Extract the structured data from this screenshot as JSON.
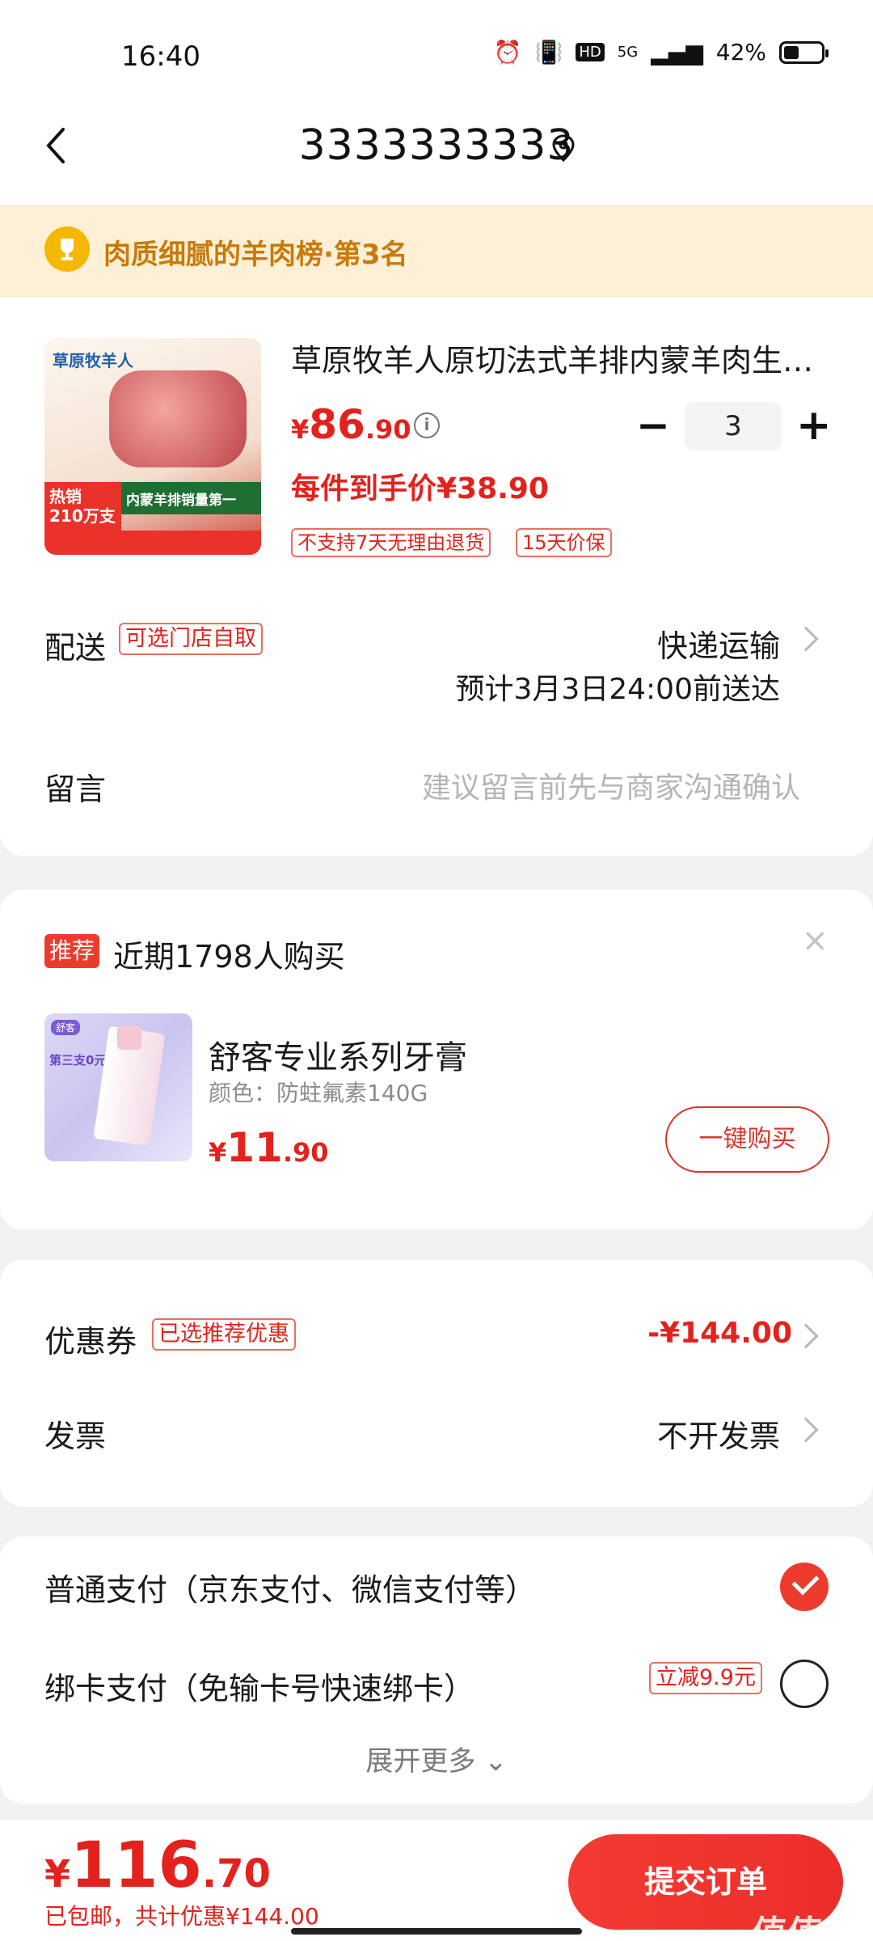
{
  "status_bar": {
    "time": "16:40",
    "network": "5G",
    "hd": "HD",
    "battery": "42%"
  },
  "header": {
    "phone": "3333333333"
  },
  "ranking": {
    "text": "肉质细腻的羊肉榜·第3名"
  },
  "product": {
    "image_brand": "草原牧羊人",
    "image_hot": "热销",
    "image_sales": "210万支",
    "image_banner": "内蒙羊排销量第一",
    "title": "草原牧羊人原切法式羊排内蒙羊肉生…",
    "price_currency": "¥",
    "price_int": "86",
    "price_dec": ".90",
    "quantity": "3",
    "unit_price": "每件到手价¥38.90",
    "tags": [
      "不支持7天无理由退货",
      "15天价保"
    ]
  },
  "delivery": {
    "label": "配送",
    "tag": "可选门店自取",
    "method": "快递运输",
    "eta": "预计3月3日24:00前送达"
  },
  "note": {
    "label": "留言",
    "placeholder": "建议留言前先与商家沟通确认"
  },
  "recommend": {
    "badge": "推荐",
    "count_text": "近期1798人购买",
    "close": "×",
    "image_pill": "舒客",
    "image_text": "第三支0元",
    "name": "舒客专业系列牙膏",
    "variant": "颜色：防蛀氟素140G",
    "price_currency": "¥",
    "price_int": "11",
    "price_dec": ".90",
    "buy_label": "一键购买"
  },
  "coupon": {
    "label": "优惠券",
    "tag": "已选推荐优惠",
    "amount": "-¥144.00"
  },
  "invoice": {
    "label": "发票",
    "value": "不开发票"
  },
  "payment": {
    "option1": "普通支付（京东支付、微信支付等）",
    "option2": "绑卡支付（免输卡号快速绑卡）",
    "option2_tag": "立减9.9元",
    "expand": "展开更多 ⌄"
  },
  "footer": {
    "total_currency": "¥",
    "total_int": "116",
    "total_dec": ".70",
    "note": "已包邮，共计优惠¥144.00",
    "submit": "提交订单",
    "watermark": "值值值"
  },
  "colors": {
    "accent": "#e3221d",
    "banner_bg": "#fdf0d6",
    "banner_text": "#c97a0a"
  }
}
